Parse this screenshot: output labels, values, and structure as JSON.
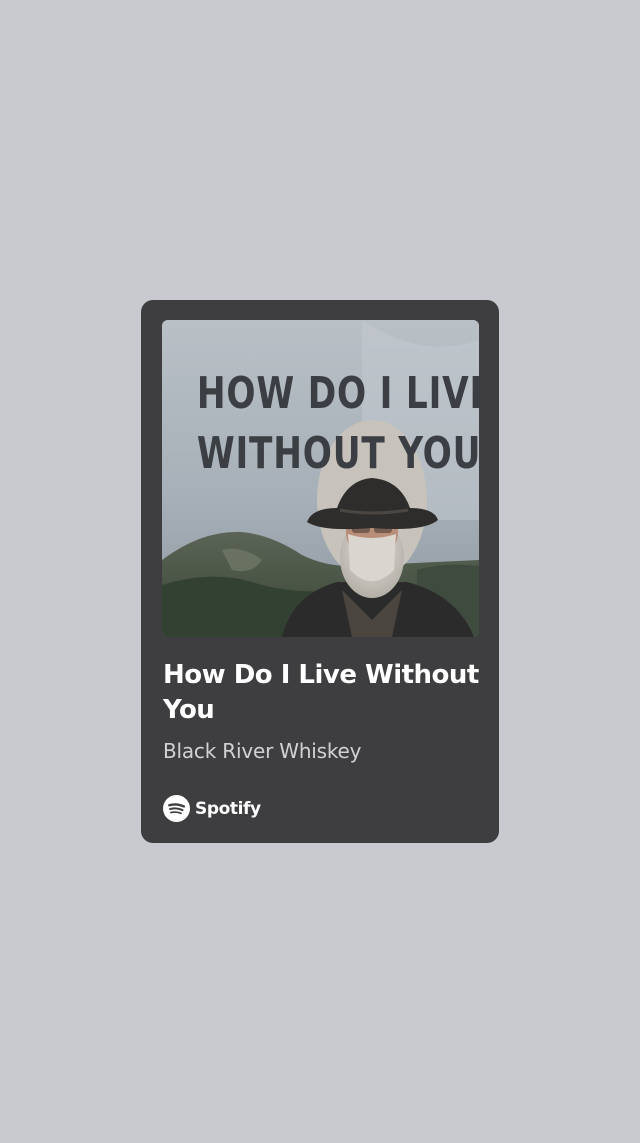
{
  "track": {
    "cover_text_line1": "HOW DO I LIVE",
    "cover_text_line2": "WITHOUT YOU",
    "title": "How Do I Live Without You",
    "artist": "Black River Whiskey"
  },
  "brand": {
    "name": "Spotify",
    "icon": "spotify-logo-icon"
  },
  "colors": {
    "background": "#c9cacf",
    "card": "#3e3e40",
    "title_text": "#ffffff",
    "artist_text": "#d2d2d4"
  }
}
